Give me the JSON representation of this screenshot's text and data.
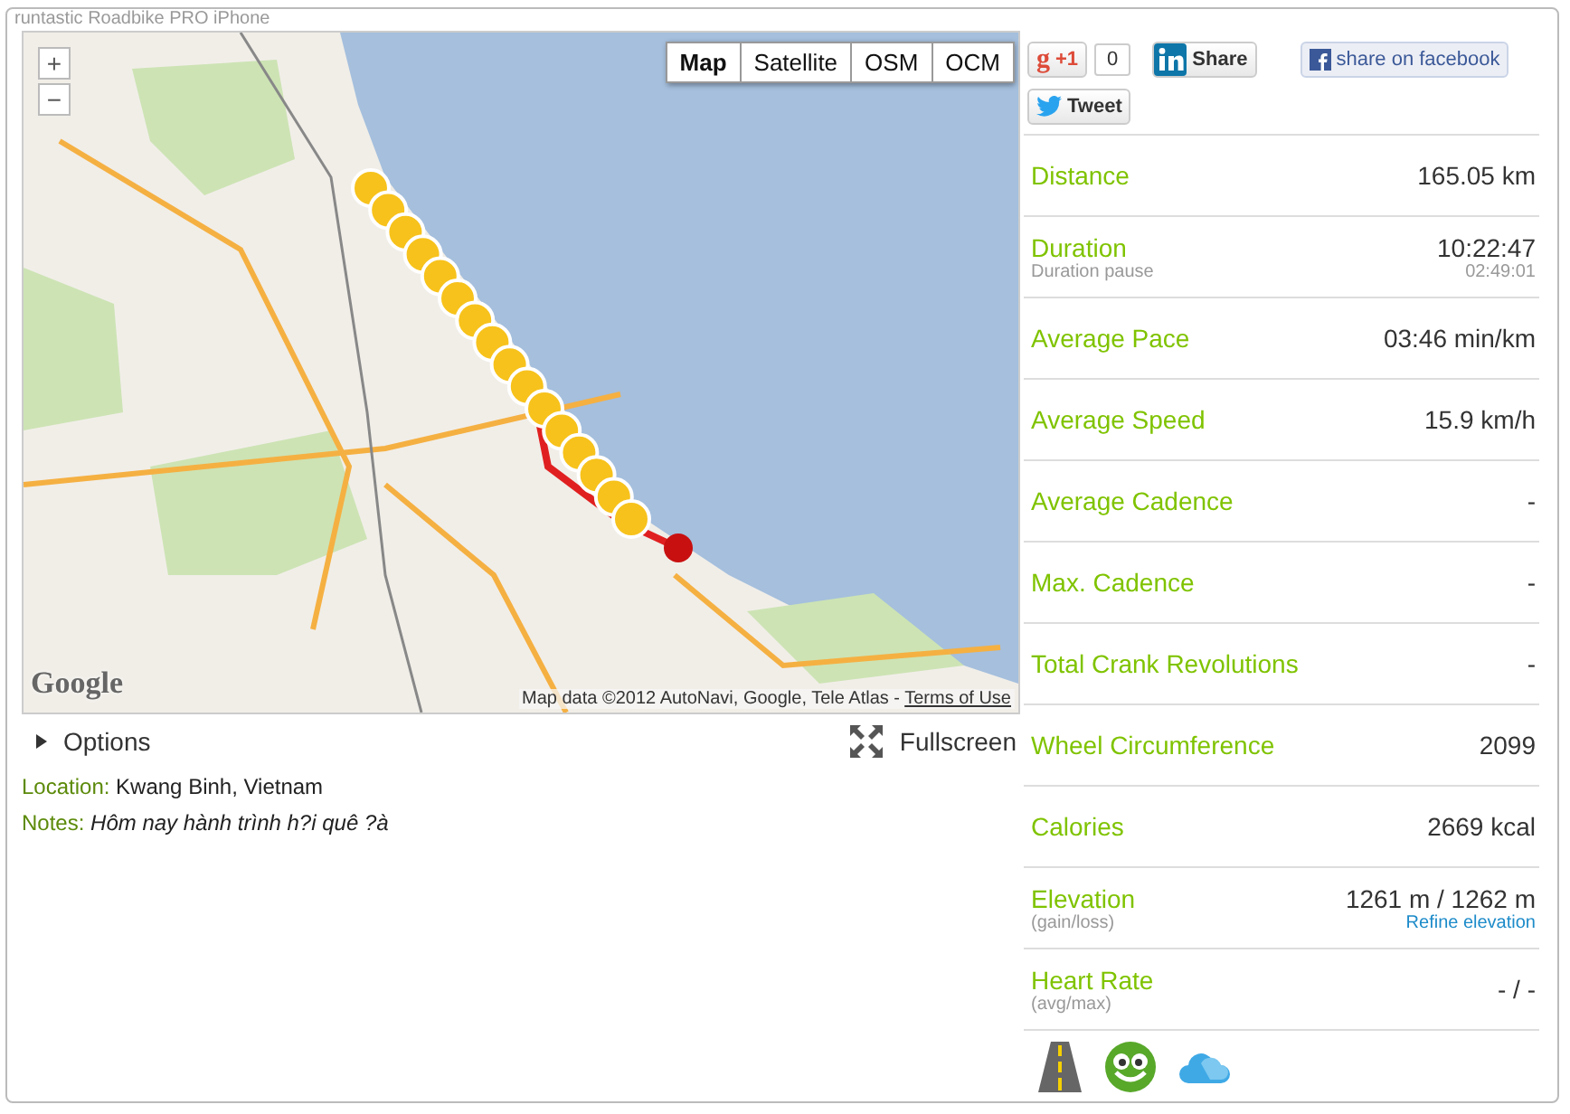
{
  "title": "runtastic Roadbike PRO iPhone",
  "map": {
    "map_types": [
      {
        "label": "Map",
        "selected": true
      },
      {
        "label": "Satellite",
        "selected": false
      },
      {
        "label": "OSM",
        "selected": false
      },
      {
        "label": "OCM",
        "selected": false
      }
    ],
    "zoom_in": "+",
    "zoom_out": "−",
    "logo": "Google",
    "attribution": "Map data ©2012 AutoNavi, Google, Tele Atlas - ",
    "terms_link": "Terms of Use"
  },
  "options": {
    "label": "Options",
    "expanded": false
  },
  "fullscreen": "Fullscreen",
  "location": {
    "label": "Location:",
    "value": "Kwang Binh, Vietnam"
  },
  "notes": {
    "label": "Notes:",
    "value": "Hôm nay hành trình h?i quê ?à"
  },
  "social": {
    "gplus_logo": "g",
    "gplus": "+1",
    "gplus_count": "0",
    "linkedin": "Share",
    "facebook": "share on facebook",
    "tweet": "Tweet"
  },
  "stats": [
    {
      "label": "Distance",
      "value": "165.05 km"
    },
    {
      "label": "Duration",
      "sublabel": "Duration pause",
      "value": "10:22:47",
      "subvalue": "02:49:01"
    },
    {
      "label": "Average Pace",
      "value": "03:46 min/km"
    },
    {
      "label": "Average Speed",
      "value": "15.9 km/h"
    },
    {
      "label": "Average Cadence",
      "value": "-"
    },
    {
      "label": "Max. Cadence",
      "value": "-"
    },
    {
      "label": "Total Crank Revolutions",
      "value": "-"
    },
    {
      "label": "Wheel Circumference",
      "value": "2099"
    },
    {
      "label": "Calories",
      "value": "2669 kcal"
    },
    {
      "label": "Elevation",
      "sublabel": "(gain/loss)",
      "value": "1261 m / 1262 m",
      "link": "Refine elevation"
    },
    {
      "label": "Heart Rate",
      "sublabel": "(avg/max)",
      "value": "- / -"
    }
  ]
}
